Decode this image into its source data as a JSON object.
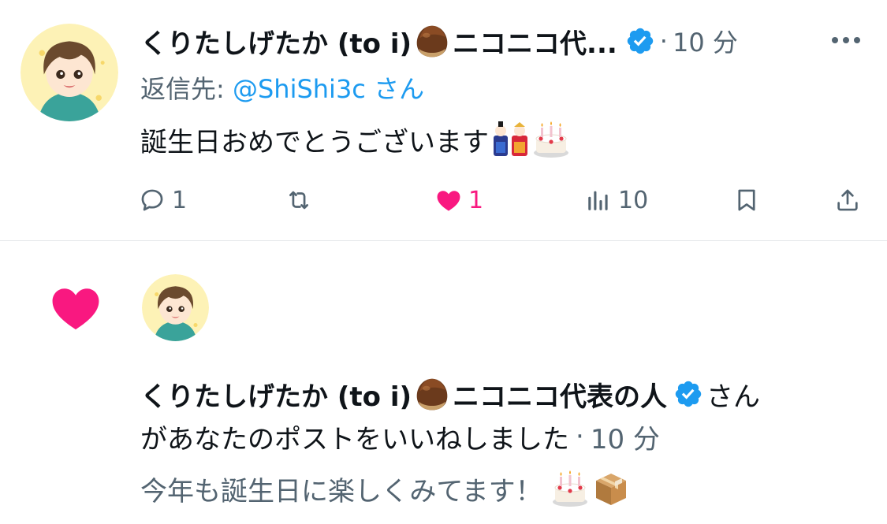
{
  "tweet": {
    "display_name": "くりたしげたか (to i)",
    "display_name_suffix": "ニコニコ代...",
    "time_separator": "·",
    "time": "10 分",
    "reply_prefix": "返信先: ",
    "reply_mention": "@ShiShi3c",
    "reply_suffix": "さん",
    "text": "誕生日おめでとうございます",
    "emojis": [
      "hina-dolls",
      "birthday-cake"
    ],
    "actions": {
      "reply_count": "1",
      "repost_count": "",
      "like_count": "1",
      "view_count": "10"
    }
  },
  "notification": {
    "name": "くりたしげたか (to i)",
    "name_suffix": "ニコニコ代表の人",
    "line1_tail": "さん",
    "line2_text": "があなたのポストをいいねしました",
    "time_separator": "·",
    "time": "10 分",
    "quote": "今年も誕生日に楽しくみてます！",
    "quote_emojis": [
      "birthday-cake",
      "package"
    ]
  },
  "colors": {
    "text": "#0f1419",
    "secondary": "#536471",
    "link": "#1d9bf0",
    "like": "#f91880",
    "verified": "#1d9bf0"
  }
}
